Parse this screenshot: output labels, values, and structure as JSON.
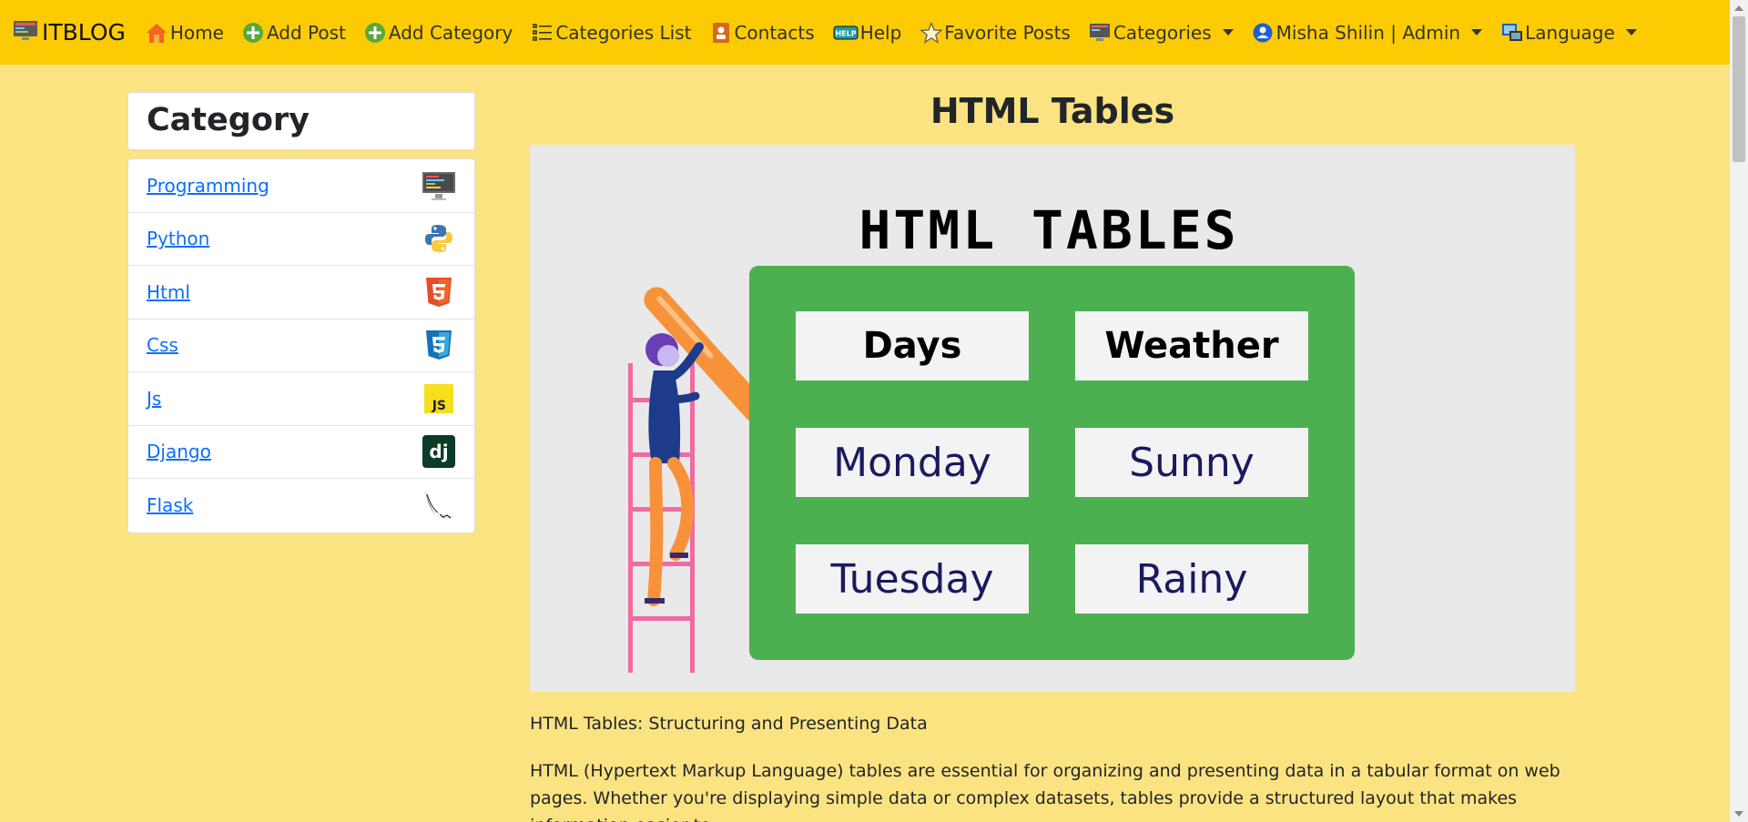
{
  "navbar": {
    "brand": "ITBLOG",
    "items": [
      {
        "label": "Home",
        "icon": "home-icon"
      },
      {
        "label": "Add Post",
        "icon": "plus-circle-icon"
      },
      {
        "label": "Add Category",
        "icon": "plus-circle-icon"
      },
      {
        "label": "Categories List",
        "icon": "list-icon"
      },
      {
        "label": "Contacts",
        "icon": "contacts-book-icon"
      },
      {
        "label": "Help",
        "icon": "help-icon"
      },
      {
        "label": "Favorite Posts",
        "icon": "star-icon"
      }
    ],
    "dropdowns": [
      {
        "label": "Categories",
        "icon": "monitor-icon"
      },
      {
        "label": "Misha Shilin | Admin",
        "icon": "user-icon"
      },
      {
        "label": "Language",
        "icon": "language-icon"
      }
    ],
    "help_badge": "HELP"
  },
  "sidebar": {
    "title": "Category",
    "items": [
      {
        "label": "Programming",
        "icon": "monitor-icon"
      },
      {
        "label": "Python",
        "icon": "python-icon"
      },
      {
        "label": "Html",
        "icon": "html5-icon"
      },
      {
        "label": "Css",
        "icon": "css3-icon"
      },
      {
        "label": "Js",
        "icon": "js-icon"
      },
      {
        "label": "Django",
        "icon": "django-icon"
      },
      {
        "label": "Flask",
        "icon": "flask-icon"
      }
    ]
  },
  "post": {
    "title": "HTML Tables",
    "image": {
      "heading": "HTML TABLES",
      "cells": [
        "Days",
        "Weather",
        "Monday",
        "Sunny",
        "Tuesday",
        "Rainy"
      ]
    },
    "subtitle": "HTML Tables: Structuring and Presenting Data",
    "body": "HTML (Hypertext Markup Language) tables are essential for organizing and presenting data in a tabular format on web pages. Whether you're displaying simple data or complex datasets, tables provide a structured layout that makes information easier to"
  },
  "colors": {
    "navbar": "#fdcb01",
    "page_background": "#fce382",
    "link": "#0d6efd",
    "board": "#4caf50"
  }
}
